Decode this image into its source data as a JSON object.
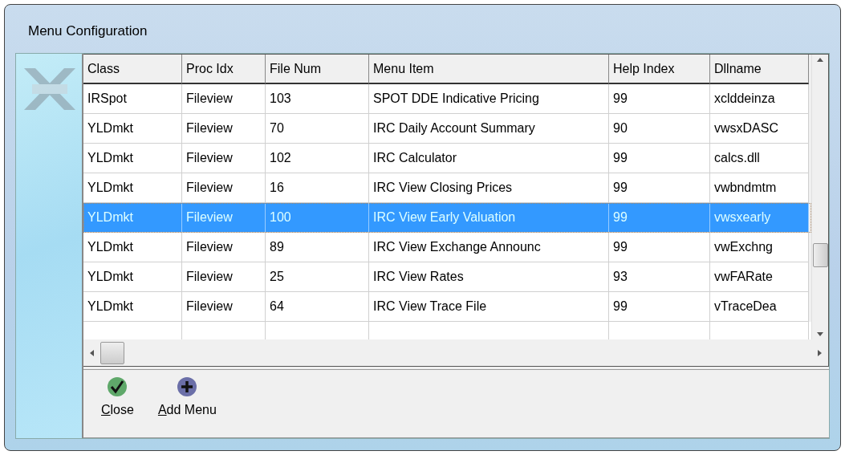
{
  "window": {
    "title": "Menu Configuration"
  },
  "table": {
    "columns": [
      "Class",
      "Proc Idx",
      "File Num",
      "Menu Item",
      "Help Index",
      "Dllname"
    ],
    "rows": [
      {
        "cells": [
          "IRSpot",
          "Fileview",
          "103",
          "SPOT DDE Indicative Pricing",
          "99",
          "xclddeinza"
        ],
        "selected": false
      },
      {
        "cells": [
          "YLDmkt",
          "Fileview",
          "70",
          "IRC Daily Account Summary",
          "90",
          "vwsxDASC"
        ],
        "selected": false
      },
      {
        "cells": [
          "YLDmkt",
          "Fileview",
          "102",
          "IRC Calculator",
          "99",
          "calcs.dll"
        ],
        "selected": false
      },
      {
        "cells": [
          "YLDmkt",
          "Fileview",
          "16",
          "IRC View Closing Prices",
          "99",
          "vwbndmtm"
        ],
        "selected": false
      },
      {
        "cells": [
          "YLDmkt",
          "Fileview",
          "100",
          "IRC View Early Valuation",
          "99",
          "vwsxearly"
        ],
        "selected": true
      },
      {
        "cells": [
          "YLDmkt",
          "Fileview",
          "89",
          "IRC View Exchange Announc",
          "99",
          "vwExchng"
        ],
        "selected": false
      },
      {
        "cells": [
          "YLDmkt",
          "Fileview",
          "25",
          "IRC View Rates",
          "93",
          "vwFARate"
        ],
        "selected": false
      },
      {
        "cells": [
          "YLDmkt",
          "Fileview",
          "64",
          "IRC View Trace File",
          "99",
          "vTraceDea"
        ],
        "selected": false
      }
    ]
  },
  "toolbar": [
    {
      "kind": "check",
      "label": "Close"
    },
    {
      "kind": "plus",
      "label": "Add Menu"
    }
  ]
}
